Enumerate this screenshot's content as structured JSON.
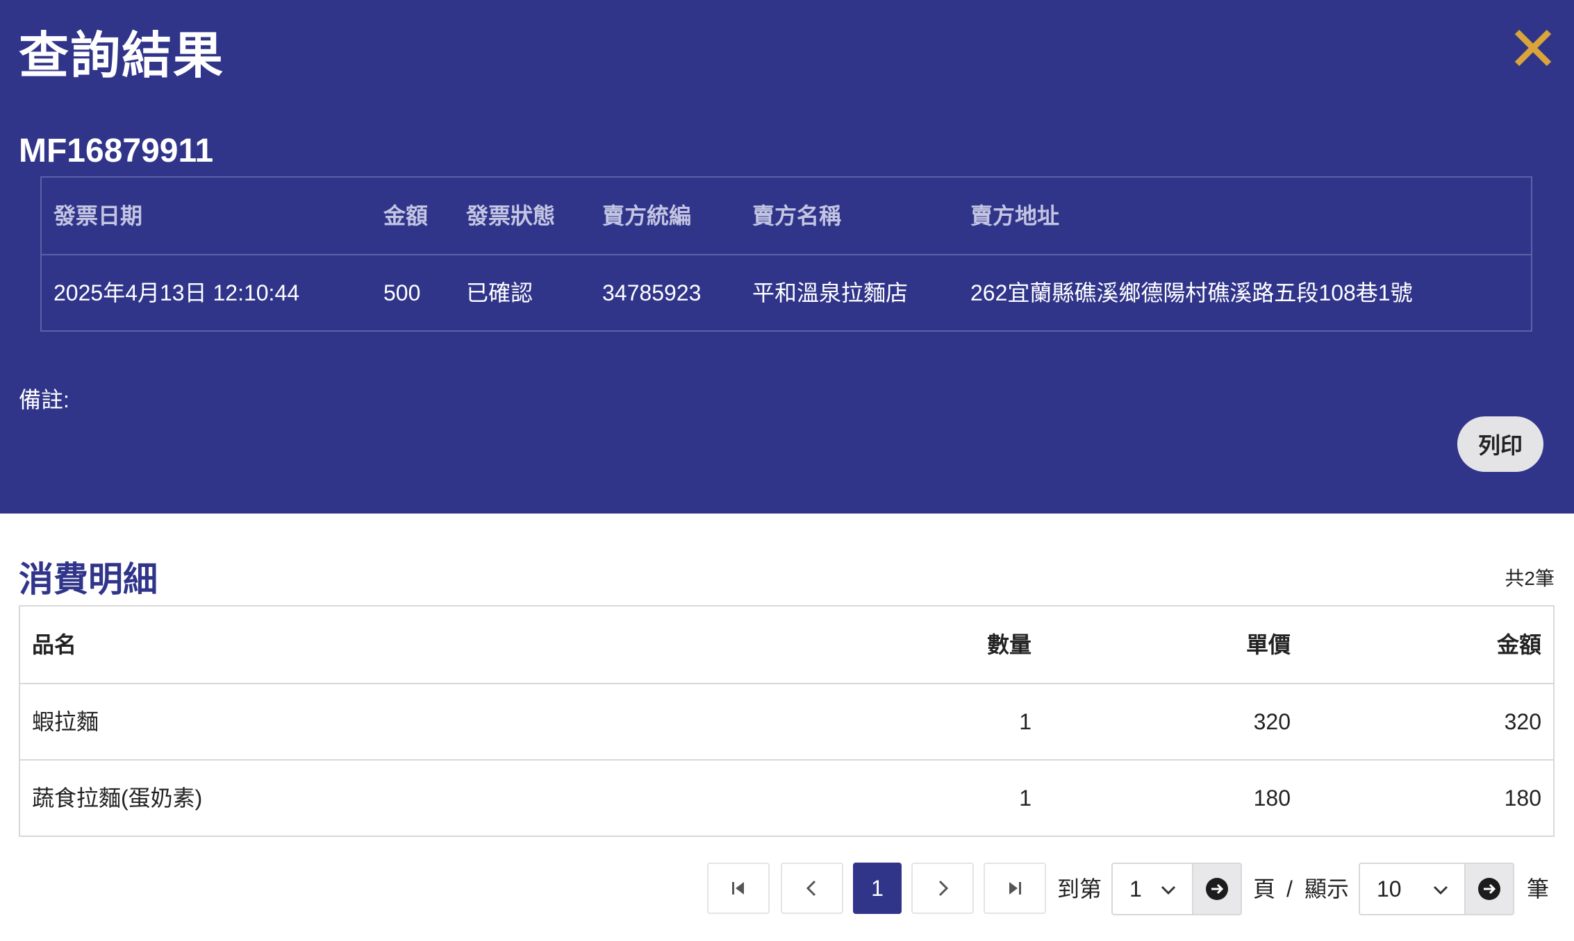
{
  "dialog": {
    "title": "查詢結果",
    "invoice_number": "MF16879911",
    "remark_label": "備註:",
    "print_label": "列印",
    "colors": {
      "header_bg": "#31358a",
      "close_icon": "#d9a43a"
    }
  },
  "invoice": {
    "headers": [
      "發票日期",
      "金額",
      "發票狀態",
      "賣方統編",
      "賣方名稱",
      "賣方地址"
    ],
    "row": {
      "date": "2025年4月13日 12:10:44",
      "amount": "500",
      "status": "已確認",
      "seller_id": "34785923",
      "seller_name": "平和溫泉拉麵店",
      "seller_address": "262宜蘭縣礁溪鄉德陽村礁溪路五段108巷1號"
    }
  },
  "details": {
    "title": "消費明細",
    "count_text": "共2筆",
    "headers": {
      "name": "品名",
      "qty": "數量",
      "unit_price": "單價",
      "amount": "金額"
    },
    "items": [
      {
        "name": "蝦拉麵",
        "qty": "1",
        "unit_price": "320",
        "amount": "320"
      },
      {
        "name": "蔬食拉麵(蛋奶素)",
        "qty": "1",
        "unit_price": "180",
        "amount": "180"
      }
    ]
  },
  "pagination": {
    "current_page": "1",
    "goto_label": "到第",
    "page_select_value": "1",
    "page_suffix": "頁",
    "separator": "/",
    "show_label": "顯示",
    "size_select_value": "10",
    "size_suffix": "筆"
  }
}
